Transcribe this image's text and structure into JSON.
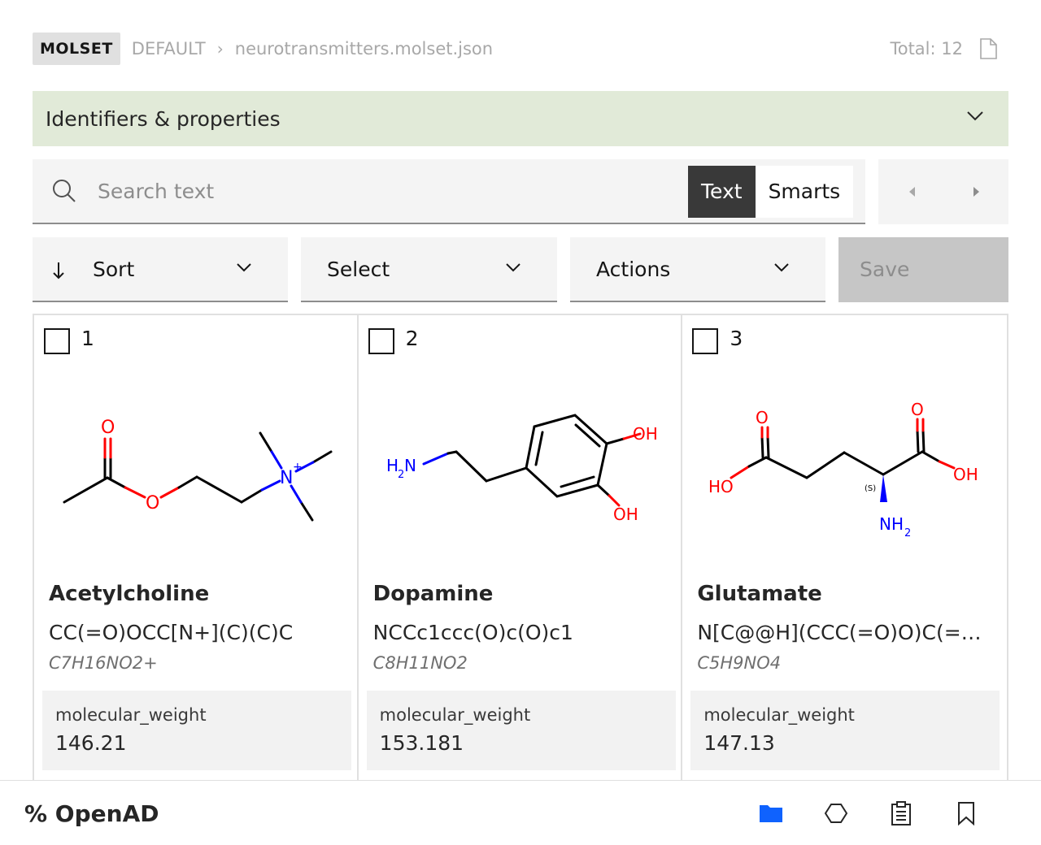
{
  "header": {
    "tag": "MOLSET",
    "workspace": "DEFAULT",
    "separator": "›",
    "file": "neurotransmitters.molset.json",
    "total": "Total: 12"
  },
  "accordion": {
    "title": "Identifiers & properties"
  },
  "search": {
    "placeholder": "Search text",
    "modes": [
      "Text",
      "Smarts"
    ],
    "active_mode": "Text"
  },
  "toolbar": {
    "sort_label": "Sort",
    "select_label": "Select",
    "actions_label": "Actions",
    "save_label": "Save"
  },
  "molecules": [
    {
      "index": "1",
      "name": "Acetylcholine",
      "smiles": "CC(=O)OCC[N+](C)(C)C",
      "formula": "C7H16NO2+",
      "prop_key": "molecular_weight",
      "prop_value": "146.21",
      "atom_labels": {
        "o1": "O",
        "o2": "O",
        "n": "N"
      }
    },
    {
      "index": "2",
      "name": "Dopamine",
      "smiles": "NCCc1ccc(O)c(O)c1",
      "formula": "C8H11NO2",
      "prop_key": "molecular_weight",
      "prop_value": "153.181",
      "atom_labels": {
        "amine": "H",
        "n": "N",
        "oh1": "OH",
        "oh2": "OH"
      }
    },
    {
      "index": "3",
      "name": "Glutamate",
      "smiles": "N[C@@H](CCC(=O)O)C(=O)O",
      "formula": "C5H9NO4",
      "prop_key": "molecular_weight",
      "prop_value": "147.13",
      "atom_labels": {
        "o1": "O",
        "o2": "O",
        "ho": "HO",
        "oh": "OH",
        "stereo": "(S)",
        "nh": "NH"
      }
    }
  ],
  "footer": {
    "brand": "% OpenAD"
  },
  "colors": {
    "accordion_bg": "#e1ead8",
    "active_icon": "#0f62fe",
    "oxygen": "#ff0000",
    "nitrogen": "#0000ff"
  }
}
